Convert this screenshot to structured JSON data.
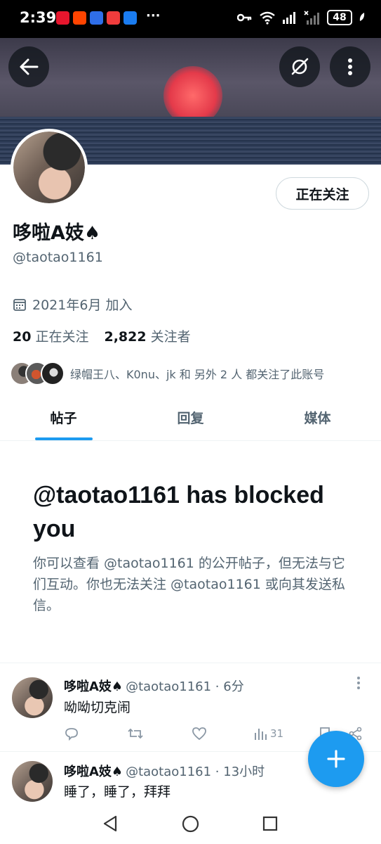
{
  "status_bar": {
    "time": "2:39",
    "more_dots": "···",
    "battery": "48"
  },
  "profile": {
    "name": "哆啦A妓",
    "name_emoji": "♠",
    "handle": "@taotao1161",
    "joined": "2021年6月 加入",
    "following_count": "20",
    "following_label": "正在关注",
    "followers_count": "2,822",
    "followers_label": "关注者",
    "followed_by_text": "绿帽王八、K0nu、jk 和 另外 2 人 都关注了此账号",
    "follow_button": "正在关注"
  },
  "tabs": [
    {
      "label": "帖子",
      "active": true
    },
    {
      "label": "回复",
      "active": false
    },
    {
      "label": "媒体",
      "active": false
    }
  ],
  "blocked": {
    "title": "@taotao1161 has blocked you",
    "body": "你可以查看 @taotao1161 的公开帖子，但无法与它们互动。你也无法关注 @taotao1161 或向其发送私信。"
  },
  "tweets": [
    {
      "name": "哆啦A妓♠",
      "meta": "@taotao1161 · 6分",
      "text": "呦呦切克闹",
      "views": "31"
    },
    {
      "name": "哆啦A妓♠",
      "meta": "@taotao1161 · 13小时",
      "text": "睡了，睡了，拜拜"
    }
  ],
  "colors": {
    "accent": "#1d9bf0",
    "text_primary": "#0f1419",
    "text_secondary": "#536471"
  }
}
